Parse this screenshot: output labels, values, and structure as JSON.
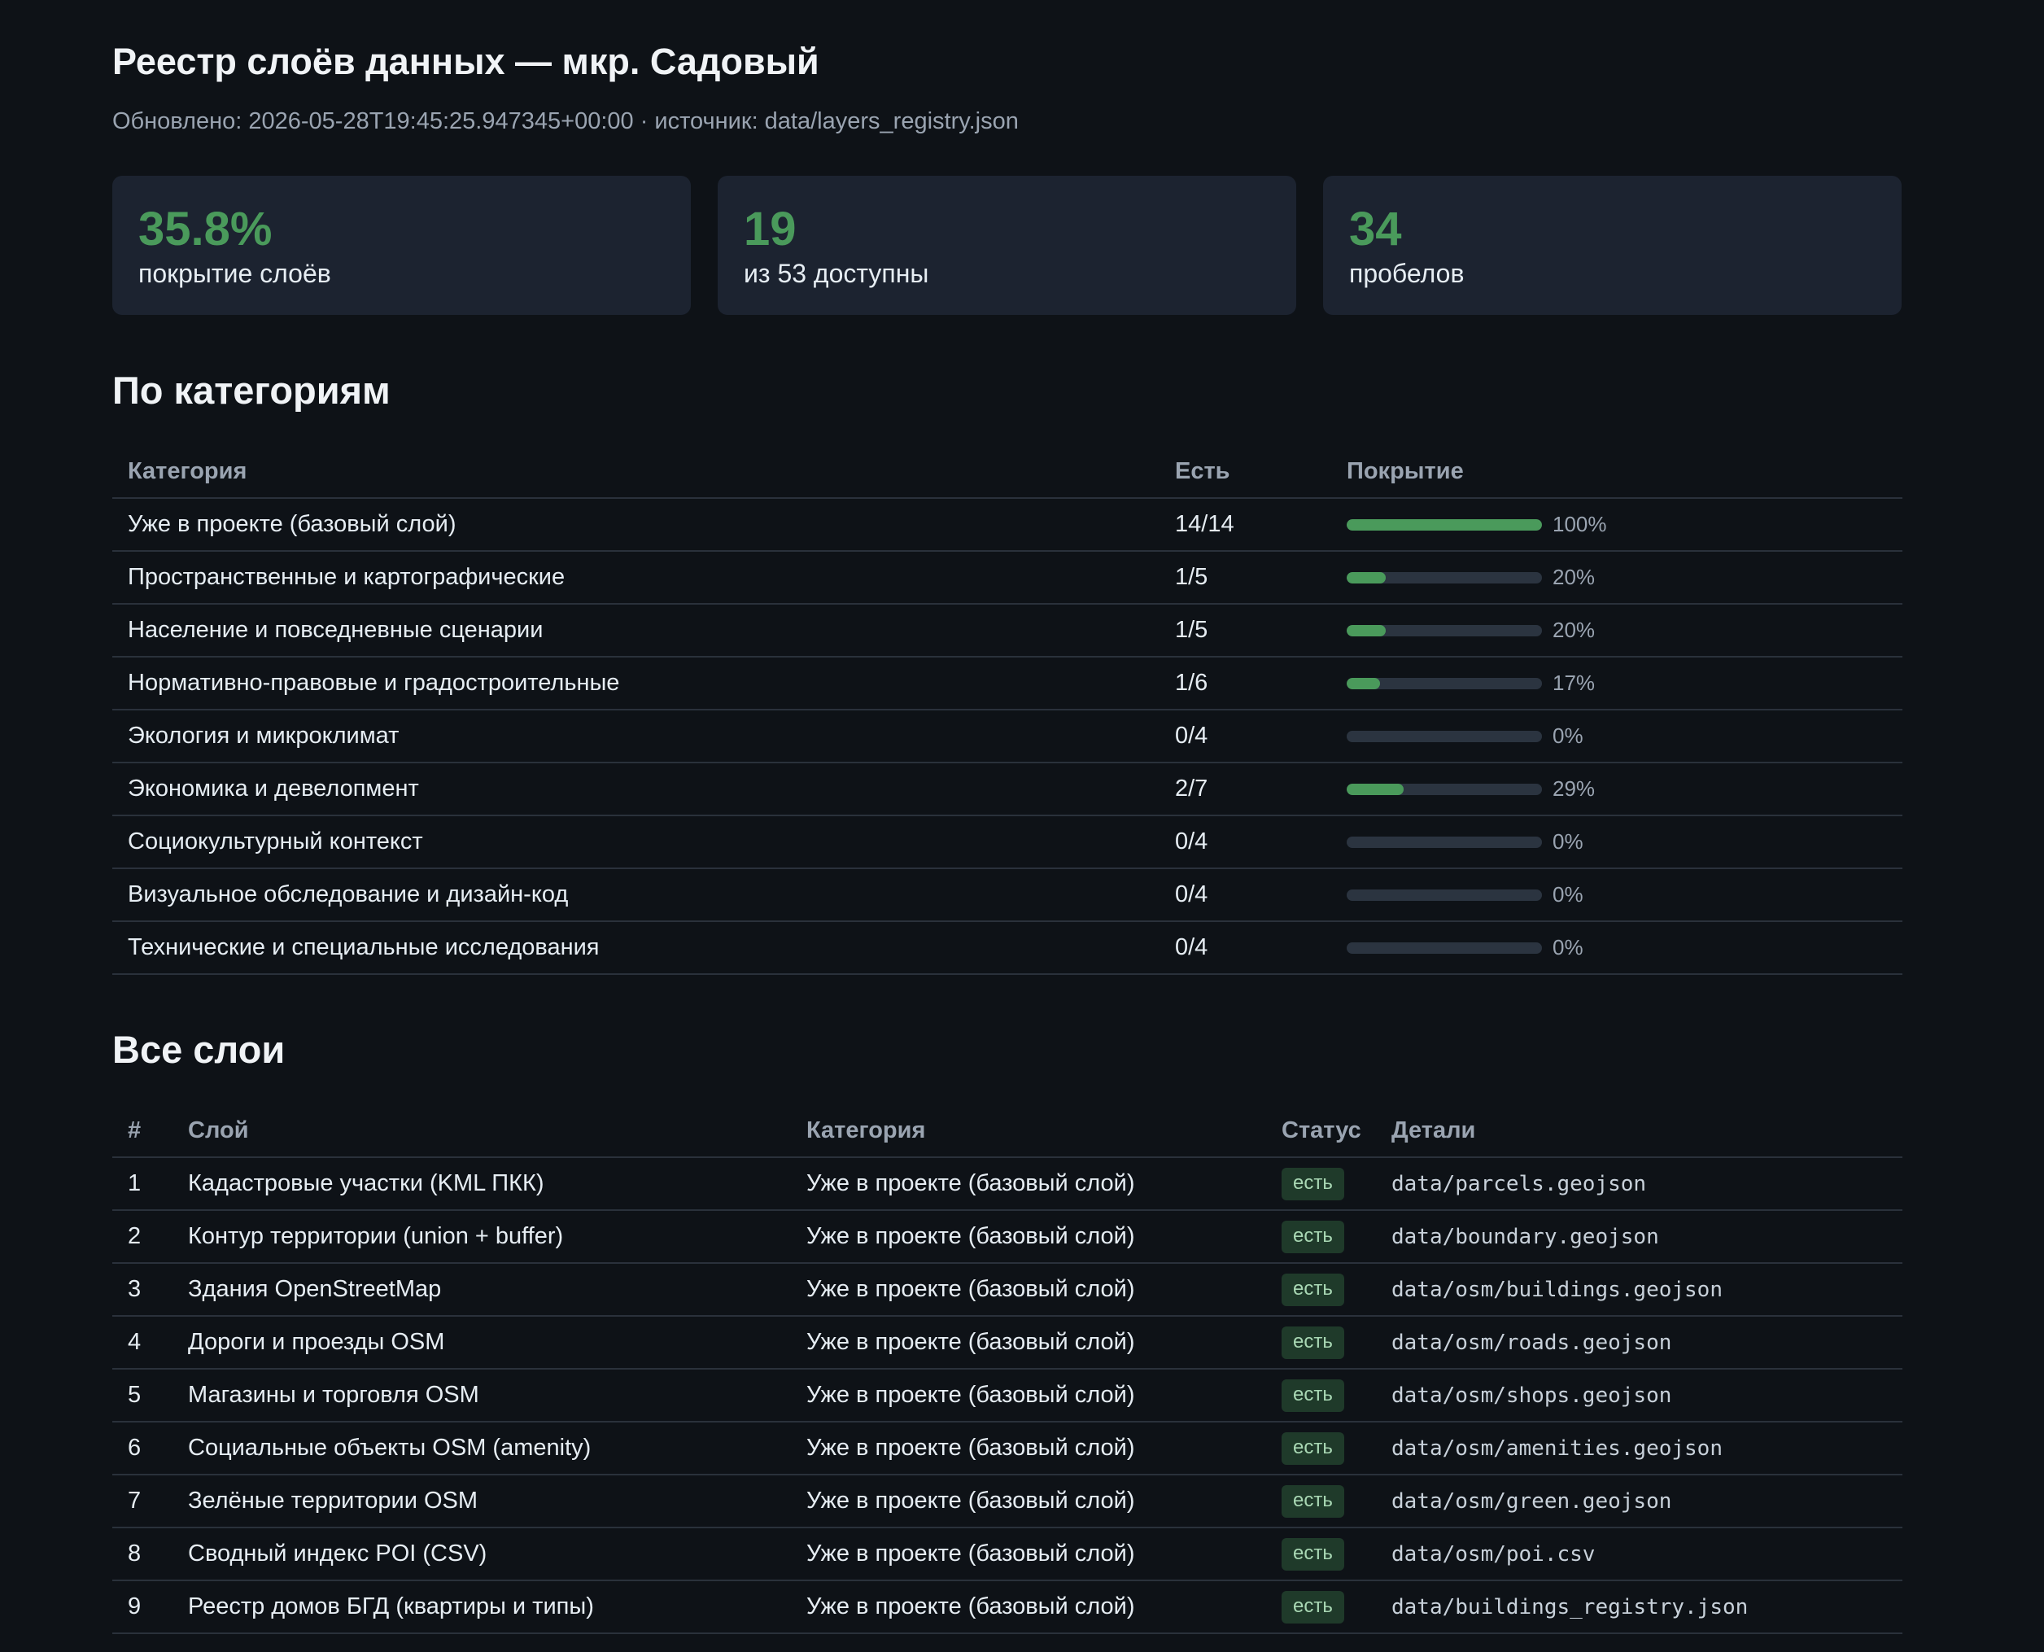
{
  "header": {
    "title": "Реестр слоёв данных — мкр. Садовый",
    "subtitle": "Обновлено: 2026-05-28T19:45:25.947345+00:00 · источник: data/layers_registry.json"
  },
  "cards": [
    {
      "value": "35.8%",
      "label": "покрытие слоёв"
    },
    {
      "value": "19",
      "label": "из 53 доступны"
    },
    {
      "value": "34",
      "label": "пробелов"
    }
  ],
  "categories_section": {
    "title": "По категориям",
    "columns": {
      "category": "Категория",
      "have": "Есть",
      "coverage": "Покрытие"
    },
    "rows": [
      {
        "category": "Уже в проекте (базовый слой)",
        "have": "14/14",
        "pct_label": "100%",
        "fraction": 1.0
      },
      {
        "category": "Пространственные и картографические",
        "have": "1/5",
        "pct_label": "20%",
        "fraction": 0.2
      },
      {
        "category": "Население и повседневные сценарии",
        "have": "1/5",
        "pct_label": "20%",
        "fraction": 0.2
      },
      {
        "category": "Нормативно-правовые и градостроительные",
        "have": "1/6",
        "pct_label": "17%",
        "fraction": 0.17
      },
      {
        "category": "Экология и микроклимат",
        "have": "0/4",
        "pct_label": "0%",
        "fraction": 0
      },
      {
        "category": "Экономика и девелопмент",
        "have": "2/7",
        "pct_label": "29%",
        "fraction": 0.29
      },
      {
        "category": "Социокультурный контекст",
        "have": "0/4",
        "pct_label": "0%",
        "fraction": 0
      },
      {
        "category": "Визуальное обследование и дизайн-код",
        "have": "0/4",
        "pct_label": "0%",
        "fraction": 0
      },
      {
        "category": "Технические и специальные исследования",
        "have": "0/4",
        "pct_label": "0%",
        "fraction": 0
      }
    ]
  },
  "layers_section": {
    "title": "Все слои",
    "columns": {
      "num": "#",
      "layer": "Слой",
      "category": "Категория",
      "status": "Статус",
      "details": "Детали"
    },
    "rows": [
      {
        "num": "1",
        "layer": "Кадастровые участки (KML ПКК)",
        "category": "Уже в проекте (базовый слой)",
        "status": "есть",
        "details": "data/parcels.geojson"
      },
      {
        "num": "2",
        "layer": "Контур территории (union + buffer)",
        "category": "Уже в проекте (базовый слой)",
        "status": "есть",
        "details": "data/boundary.geojson"
      },
      {
        "num": "3",
        "layer": "Здания OpenStreetMap",
        "category": "Уже в проекте (базовый слой)",
        "status": "есть",
        "details": "data/osm/buildings.geojson"
      },
      {
        "num": "4",
        "layer": "Дороги и проезды OSM",
        "category": "Уже в проекте (базовый слой)",
        "status": "есть",
        "details": "data/osm/roads.geojson"
      },
      {
        "num": "5",
        "layer": "Магазины и торговля OSM",
        "category": "Уже в проекте (базовый слой)",
        "status": "есть",
        "details": "data/osm/shops.geojson"
      },
      {
        "num": "6",
        "layer": "Социальные объекты OSM (amenity)",
        "category": "Уже в проекте (базовый слой)",
        "status": "есть",
        "details": "data/osm/amenities.geojson"
      },
      {
        "num": "7",
        "layer": "Зелёные территории OSM",
        "category": "Уже в проекте (базовый слой)",
        "status": "есть",
        "details": "data/osm/green.geojson"
      },
      {
        "num": "8",
        "layer": "Сводный индекс POI (CSV)",
        "category": "Уже в проекте (базовый слой)",
        "status": "есть",
        "details": "data/osm/poi.csv"
      },
      {
        "num": "9",
        "layer": "Реестр домов БГД (квартиры и типы)",
        "category": "Уже в проекте (базовый слой)",
        "status": "есть",
        "details": "data/buildings_registry.json"
      }
    ]
  }
}
